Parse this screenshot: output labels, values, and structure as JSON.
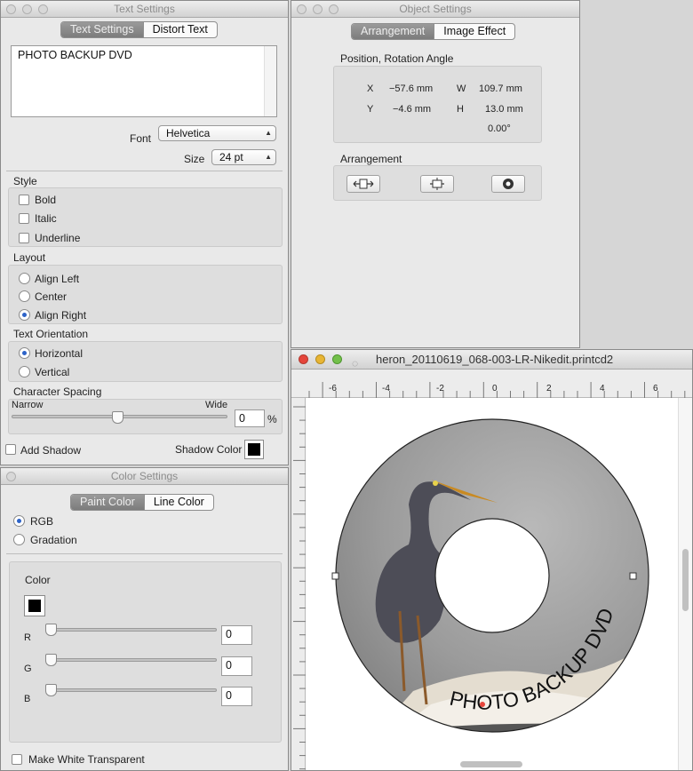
{
  "text_settings": {
    "title": "Text Settings",
    "tabs": [
      "Text Settings",
      "Distort Text"
    ],
    "text_value": "PHOTO BACKUP DVD",
    "font_label": "Font",
    "font_value": "Helvetica",
    "size_label": "Size",
    "size_value": "24 pt",
    "style_heading": "Style",
    "style_options": [
      "Bold",
      "Italic",
      "Underline"
    ],
    "layout_heading": "Layout",
    "layout_options": [
      "Align Left",
      "Center",
      "Align Right"
    ],
    "layout_selected": "Align Right",
    "orientation_heading": "Text Orientation",
    "orientation_options": [
      "Horizontal",
      "Vertical"
    ],
    "orientation_selected": "Horizontal",
    "spacing_heading": "Character Spacing",
    "spacing_narrow": "Narrow",
    "spacing_wide": "Wide",
    "spacing_value": "0",
    "spacing_unit": "%",
    "add_shadow_label": "Add Shadow",
    "shadow_color_label": "Shadow Color",
    "shadow_color": "#000000"
  },
  "object_settings": {
    "title": "Object Settings",
    "tabs": [
      "Arrangement",
      "Image Effect"
    ],
    "position_heading": "Position, Rotation Angle",
    "x_label": "X",
    "x_value": "−57.6 mm",
    "y_label": "Y",
    "y_value": "−4.6 mm",
    "w_label": "W",
    "w_value": "109.7 mm",
    "h_label": "H",
    "h_value": "13.0 mm",
    "angle_value": "0.00°",
    "arrangement_heading": "Arrangement"
  },
  "color_settings": {
    "title": "Color Settings",
    "tabs": [
      "Paint Color",
      "Line Color"
    ],
    "mode_options": [
      "RGB",
      "Gradation"
    ],
    "mode_selected": "RGB",
    "color_label": "Color",
    "swatch": "#000000",
    "r_label": "R",
    "r_value": "0",
    "g_label": "G",
    "g_value": "0",
    "b_label": "B",
    "b_value": "0",
    "make_white_transparent_label": "Make White Transparent"
  },
  "document": {
    "title": "heron_20110619_068-003-LR-Nikedit.printcd2",
    "ruler_labels": [
      "6",
      "4",
      "2",
      "0",
      "2",
      "4",
      "6"
    ],
    "ruler_signs": [
      "-",
      "-",
      "-",
      "",
      "",
      "",
      ""
    ],
    "disc_text": "PHOTO BACKUP DVD",
    "accent_red": "#e5453b",
    "accent_yellow": "#e8b534",
    "accent_green": "#73c04a"
  }
}
